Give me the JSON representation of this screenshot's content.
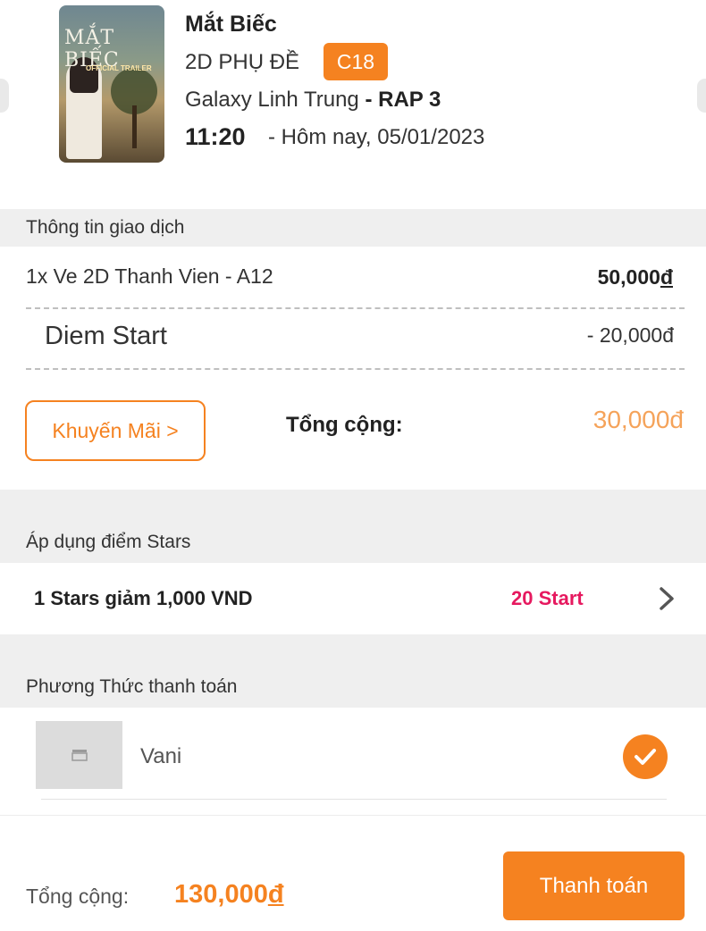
{
  "movie": {
    "title": "Mắt Biếc",
    "format": "2D PHỤ ĐỀ",
    "rating": "C18",
    "cinema": "Galaxy Linh Trung",
    "room": "- RAP 3",
    "time": "11:20",
    "date": "- Hôm nay, 05/01/2023",
    "poster_title": "MẮT BIẾC",
    "poster_sub": "OFFICIAL TRAILER"
  },
  "transaction": {
    "section_title": "Thông tin giao dịch",
    "item_label": "1x  Ve 2D Thanh Vien - A12",
    "item_price": "50,000",
    "currency": "đ",
    "discount_label": "Diem Start",
    "discount_value": "- 20,000đ",
    "promo_button": "Khuyến Mãi >",
    "total_label": "Tổng cộng:",
    "total_value": "30,000đ"
  },
  "stars": {
    "section_title": "Áp dụng điểm Stars",
    "rate_label": "1 Stars giảm 1,000 VND",
    "value": "20 Start"
  },
  "payment": {
    "section_title": "Phương Thức thanh toán",
    "method_name": "Vani",
    "method_icon": "clapperboard-icon",
    "selected": true
  },
  "footer": {
    "total_label": "Tổng cộng:",
    "total_value": "130,000",
    "currency": "đ",
    "pay_button": "Thanh toán"
  },
  "colors": {
    "accent": "#f58220",
    "stars_value": "#e6195f",
    "section_bg": "#efefef"
  }
}
